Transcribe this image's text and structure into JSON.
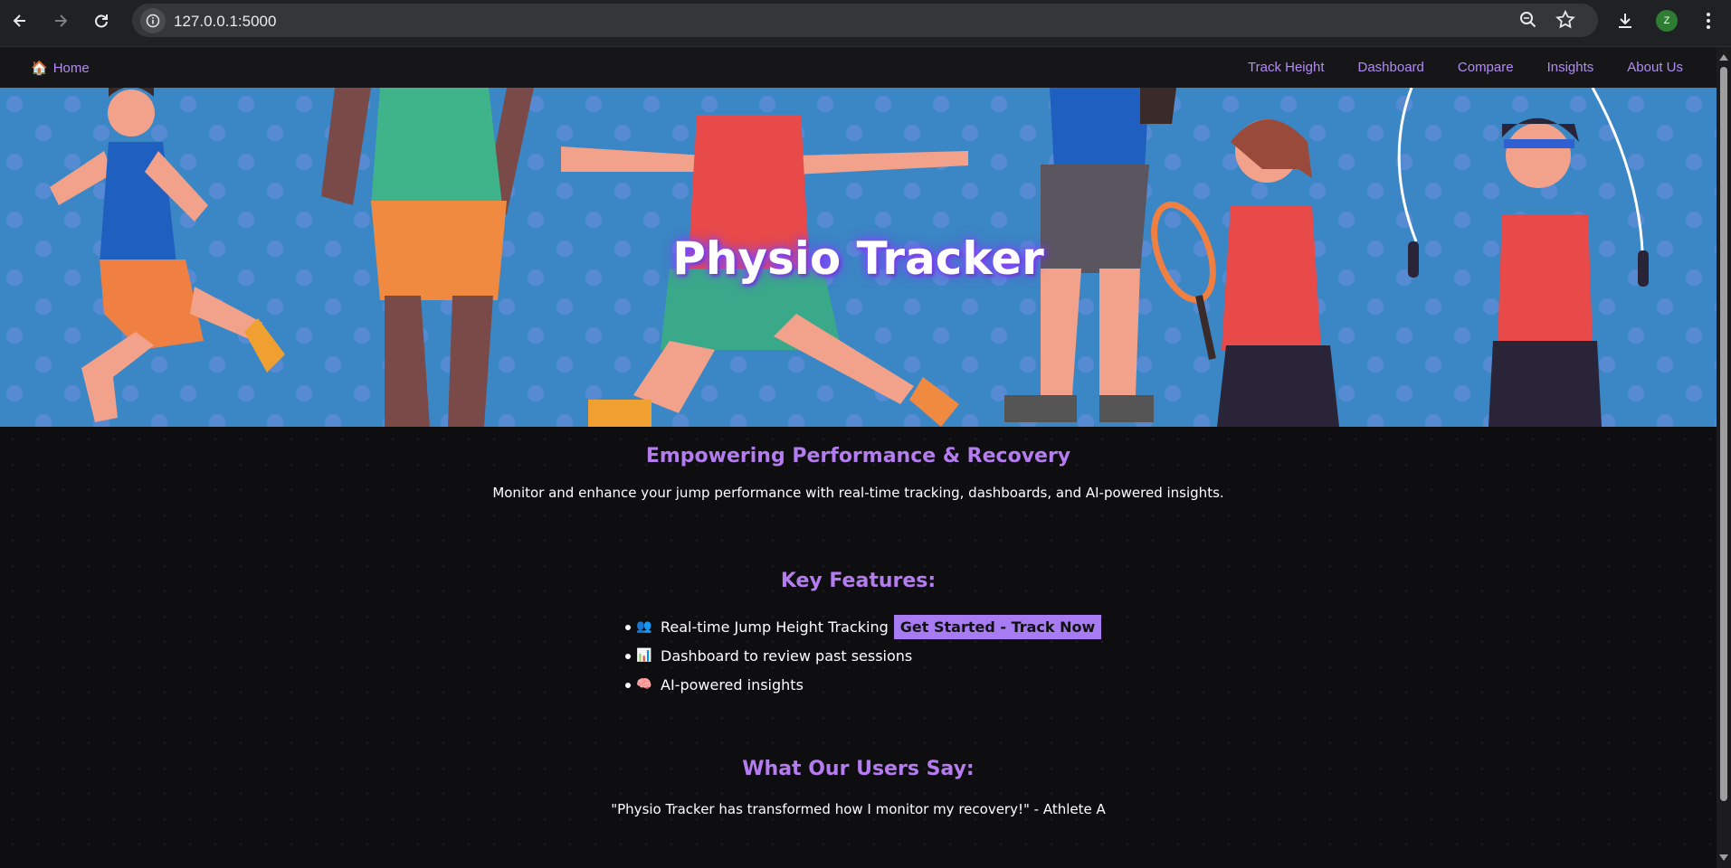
{
  "browser": {
    "url": "127.0.0.1:5000",
    "profile_initial": "Z"
  },
  "nav": {
    "home_icon": "🏠",
    "home_label": "Home",
    "links": [
      "Track Height",
      "Dashboard",
      "Compare",
      "Insights",
      "About Us"
    ]
  },
  "hero": {
    "title": "Physio Tracker"
  },
  "intro": {
    "heading": "Empowering Performance & Recovery",
    "text": "Monitor and enhance your jump performance with real-time tracking, dashboards, and AI-powered insights."
  },
  "features": {
    "heading": "Key Features:",
    "items": [
      {
        "icon": "👥",
        "text": "Real-time Jump Height Tracking"
      },
      {
        "icon": "📊",
        "text": "Dashboard to review past sessions"
      },
      {
        "icon": "🧠",
        "text": "AI-powered insights"
      }
    ],
    "cta_label": "Get Started - Track Now"
  },
  "testimonials": {
    "heading": "What Our Users Say:",
    "quote": "\"Physio Tracker has transformed how I monitor my recovery!\" - Athlete A"
  },
  "colors": {
    "accent": "#b57cf0",
    "cta_bg": "#a77cf2",
    "hero_bg": "#3b86c4",
    "page_bg": "#0e0e10"
  }
}
